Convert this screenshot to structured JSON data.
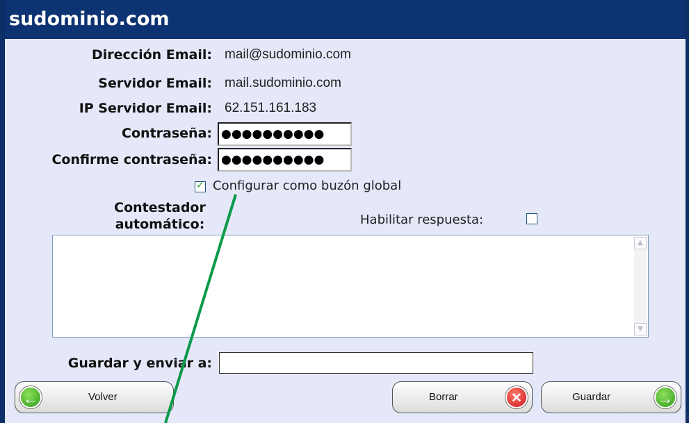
{
  "title": "sudominio.com",
  "fields": {
    "email_label": "Dirección Email:",
    "email_value": "mail@sudominio.com",
    "server_label": "Servidor Email:",
    "server_value": "mail.sudominio.com",
    "ip_label": "IP Servidor Email:",
    "ip_value": "62.151.161.183",
    "password_label": "Contraseña:",
    "password_value": "●●●●●●●●●●",
    "confirm_label": "Confirme contraseña:",
    "confirm_value": "●●●●●●●●●●"
  },
  "global_checkbox": {
    "label": "Configurar como buzón global",
    "checked": true
  },
  "autoresponder": {
    "label_line1": "Contestador",
    "label_line2": "automático:",
    "enable_label": "Habilitar respuesta:",
    "enable_checked": false,
    "text": ""
  },
  "forward": {
    "label": "Guardar y enviar a:",
    "value": ""
  },
  "buttons": {
    "back": "Volver",
    "delete": "Borrar",
    "save": "Guardar"
  },
  "colors": {
    "title_bg": "#0d3372",
    "panel_bg": "#e5e8f8",
    "annotation": "#0a9a4a"
  }
}
